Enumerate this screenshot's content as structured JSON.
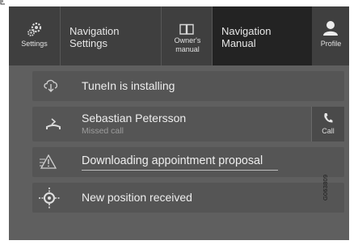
{
  "topbar": {
    "tabs": [
      {
        "id": "settings",
        "label": "Settings",
        "icon": "gear-icon",
        "active": false
      },
      {
        "id": "navigation-settings",
        "label": "Navigation Settings",
        "active": false
      },
      {
        "id": "owners-manual",
        "label": "Owner's manual",
        "icon": "book-icon",
        "active": false
      },
      {
        "id": "navigation-manual",
        "label": "Navigation Manual",
        "active": true
      },
      {
        "id": "profile",
        "label": "Profile",
        "icon": "person-icon",
        "active": false
      }
    ]
  },
  "notifications": [
    {
      "id": "tunein",
      "icon": "cloud-download-icon",
      "title": "TuneIn is installing"
    },
    {
      "id": "missed-call",
      "icon": "missed-call-icon",
      "title": "Sebastian Petersson",
      "subtitle": "Missed call",
      "action": {
        "label": "Call",
        "icon": "phone-icon"
      }
    },
    {
      "id": "appointment",
      "icon": "warning-road-icon",
      "title": "Downloading appointment proposal",
      "underlined": true
    },
    {
      "id": "position",
      "icon": "gps-position-icon",
      "title": "New position received"
    }
  ],
  "image_id": "G063809",
  "colors": {
    "screen_bg": "#5f5f5f",
    "topbar_bg": "#3f3f3f",
    "active_tab_bg": "#232323",
    "text": "#eeeeee"
  }
}
